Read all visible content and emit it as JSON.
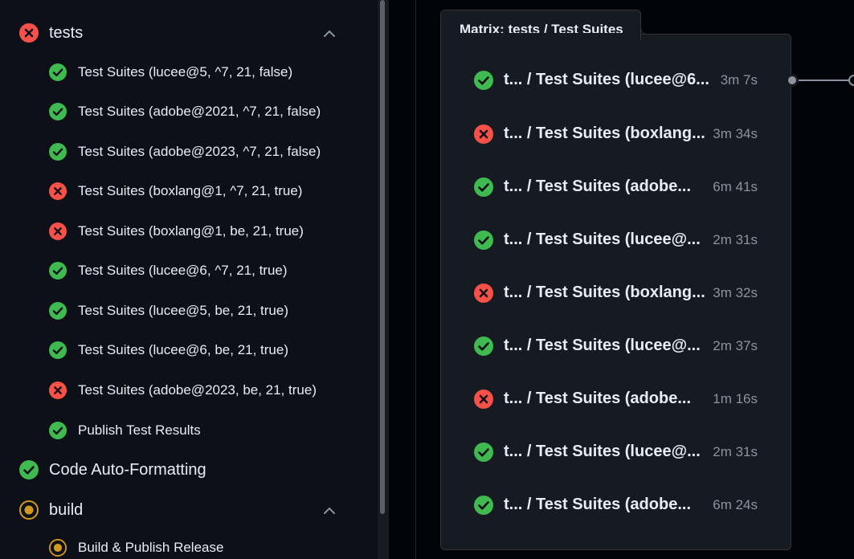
{
  "colors": {
    "success": "#3fb950",
    "failure": "#f85149",
    "in_progress": "#d29922"
  },
  "jobs": {
    "tests": {
      "label": "tests",
      "status": "failure",
      "icon": "x-circle-icon",
      "expanded": true,
      "steps": [
        {
          "label": "Test Suites (lucee@5, ^7, 21, false)",
          "status": "success"
        },
        {
          "label": "Test Suites (adobe@2021, ^7, 21, false)",
          "status": "success"
        },
        {
          "label": "Test Suites (adobe@2023, ^7, 21, false)",
          "status": "success"
        },
        {
          "label": "Test Suites (boxlang@1, ^7, 21, true)",
          "status": "failure"
        },
        {
          "label": "Test Suites (boxlang@1, be, 21, true)",
          "status": "failure"
        },
        {
          "label": "Test Suites (lucee@6, ^7, 21, true)",
          "status": "success"
        },
        {
          "label": "Test Suites (lucee@5, be, 21, true)",
          "status": "success"
        },
        {
          "label": "Test Suites (lucee@6, be, 21, true)",
          "status": "success"
        },
        {
          "label": "Test Suites (adobe@2023, be, 21, true)",
          "status": "failure"
        },
        {
          "label": "Publish Test Results",
          "status": "success"
        }
      ]
    },
    "format": {
      "label": "Code Auto-Formatting",
      "status": "success",
      "icon": "check-circle-icon"
    },
    "build": {
      "label": "build",
      "status": "in_progress",
      "icon": "in-progress-icon",
      "expanded": true,
      "steps": [
        {
          "label": "Build & Publish Release",
          "status": "in_progress"
        }
      ]
    }
  },
  "matrix": {
    "title": "Matrix: tests / Test Suites",
    "items": [
      {
        "name": "t... / Test Suites (lucee@6...",
        "duration": "3m 7s",
        "status": "success"
      },
      {
        "name": "t... / Test Suites (boxlang...",
        "duration": "3m 34s",
        "status": "failure"
      },
      {
        "name": "t... / Test Suites (adobe...",
        "duration": "6m 41s",
        "status": "success"
      },
      {
        "name": "t... / Test Suites (lucee@...",
        "duration": "2m 31s",
        "status": "success"
      },
      {
        "name": "t... / Test Suites (boxlang...",
        "duration": "3m 32s",
        "status": "failure"
      },
      {
        "name": "t... / Test Suites (lucee@...",
        "duration": "2m 37s",
        "status": "success"
      },
      {
        "name": "t... / Test Suites (adobe...",
        "duration": "1m 16s",
        "status": "failure"
      },
      {
        "name": "t... / Test Suites (lucee@...",
        "duration": "2m 31s",
        "status": "success"
      },
      {
        "name": "t... / Test Suites (adobe...",
        "duration": "6m 24s",
        "status": "success"
      }
    ]
  }
}
